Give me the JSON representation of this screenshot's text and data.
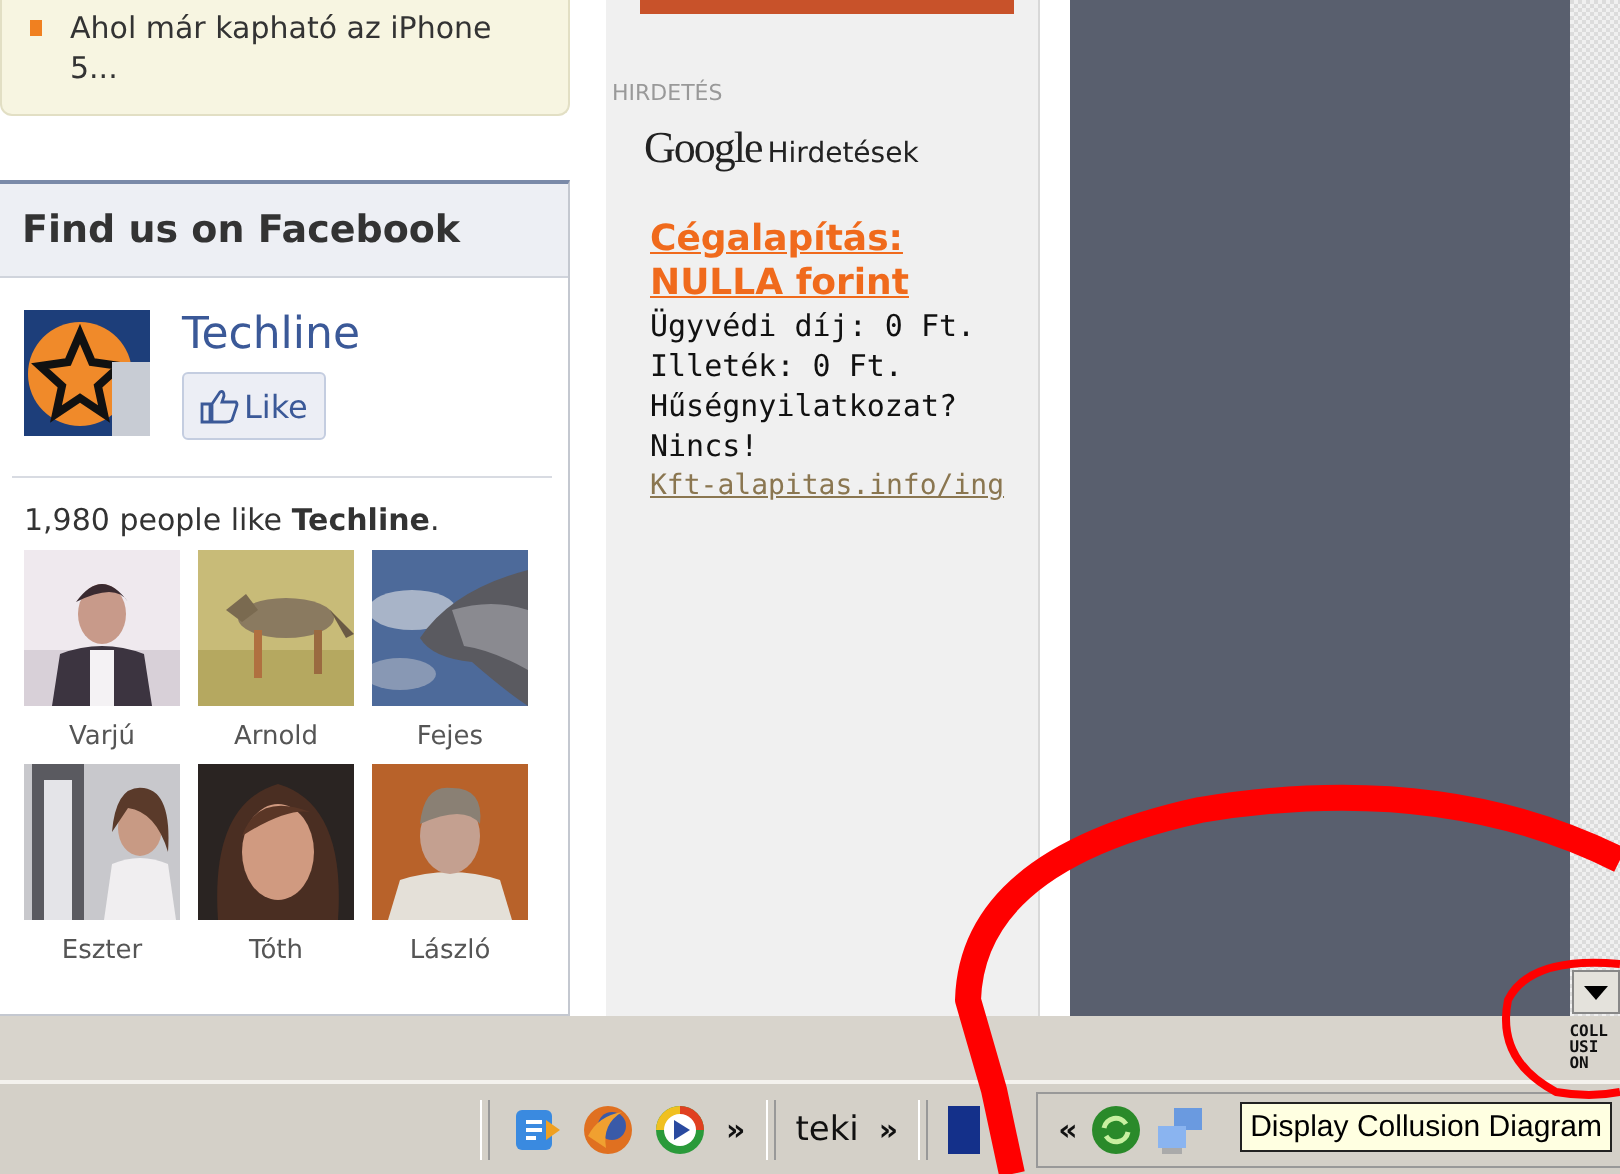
{
  "news_box": {
    "items": [
      {
        "text": "Ahol már kapható az iPhone 5..."
      }
    ]
  },
  "facebook_box": {
    "title": "Find us on Facebook",
    "page_name": "Techline",
    "like_button": "Like",
    "like_count_text": "1,980 people like **Techline**.",
    "fans": [
      {
        "name": "Varjú"
      },
      {
        "name": "Arnold"
      },
      {
        "name": "Fejes"
      },
      {
        "name": "Eszter"
      },
      {
        "name": "Tóth"
      },
      {
        "name": "László"
      }
    ]
  },
  "ad_column": {
    "label": "HIRDETÉS",
    "provider_logo": "Google",
    "provider_text": "Hirdetések",
    "ad": {
      "title": "Cégalapítás: NULLA forint",
      "lines": [
        "Ügyvédi díj: 0 Ft.",
        "Illeték: 0 Ft.",
        "Hűségnyilatkozat?",
        "Nincs!"
      ],
      "url": "Kft-alapitas.info/ing"
    }
  },
  "status_bar": {
    "collusion_icon": [
      "COLL",
      "USI",
      "ON"
    ]
  },
  "taskbar": {
    "quick_launch_more": "»",
    "toolbar_label": "teki",
    "toolbar_more": "»",
    "tray_expand": "«",
    "tooltip": "Display Collusion Diagram"
  }
}
